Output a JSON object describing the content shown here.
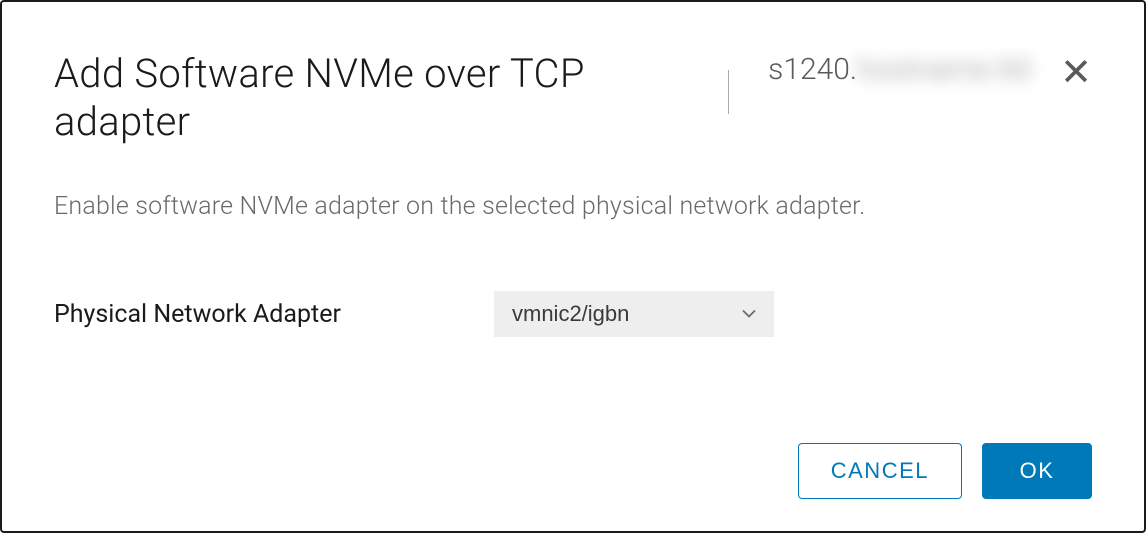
{
  "dialog": {
    "title": "Add Software NVMe over TCP adapter",
    "host_prefix": "s1240.",
    "host_blurred": "hostname.tld",
    "description": "Enable software NVMe adapter on the selected physical network adapter."
  },
  "form": {
    "adapter_label": "Physical Network Adapter",
    "adapter_value": "vmnic2/igbn"
  },
  "buttons": {
    "cancel": "CANCEL",
    "ok": "OK"
  },
  "icons": {
    "close": "close-icon",
    "chevron": "chevron-down-icon"
  }
}
